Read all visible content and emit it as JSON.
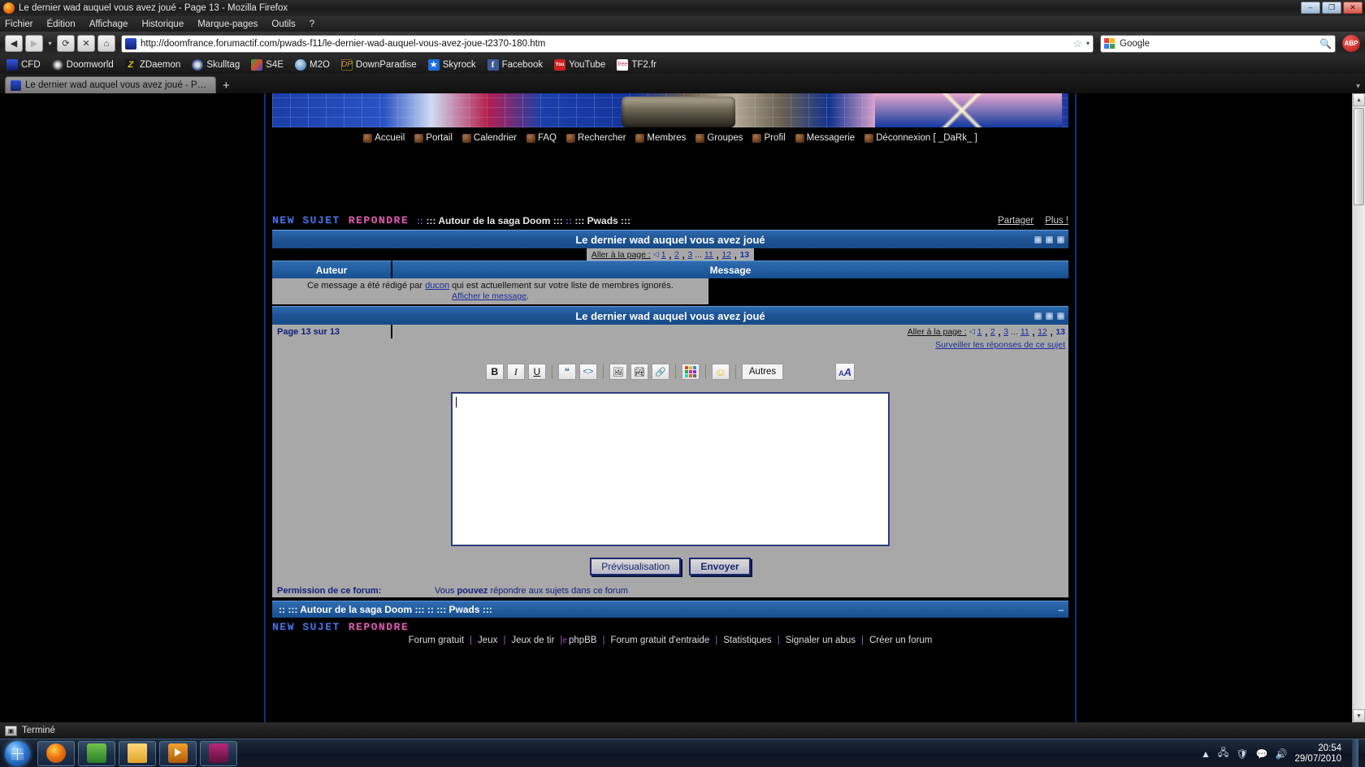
{
  "window": {
    "title": "Le dernier wad auquel vous avez joué - Page 13 - Mozilla Firefox",
    "minimize": "–",
    "maximize": "❐",
    "close": "✕"
  },
  "menubar": [
    "Fichier",
    "Édition",
    "Affichage",
    "Historique",
    "Marque-pages",
    "Outils",
    "?"
  ],
  "toolbar": {
    "back": "◀",
    "forward": "▶",
    "dropdown": "▾",
    "reload": "⟳",
    "stop": "✕",
    "home": "⌂",
    "url": "http://doomfrance.forumactif.com/pwads-f11/le-dernier-wad-auquel-vous-avez-joue-t2370-180.htm",
    "star": "☆",
    "star_caret": "▾",
    "search_value": "Google",
    "search_mag": "🔍",
    "adblock": "ABP"
  },
  "bookmarks": [
    {
      "label": "CFD",
      "icon": "cfd-icon"
    },
    {
      "label": "Doomworld",
      "icon": "doomworld-icon"
    },
    {
      "label": "ZDaemon",
      "icon": "zdaemon-icon",
      "glyph": "Z"
    },
    {
      "label": "Skulltag",
      "icon": "skulltag-icon"
    },
    {
      "label": "S4E",
      "icon": "s4e-icon"
    },
    {
      "label": "M2O",
      "icon": "m2o-icon"
    },
    {
      "label": "DownParadise",
      "icon": "downparadise-icon",
      "glyph": "DP"
    },
    {
      "label": "Skyrock",
      "icon": "skyrock-icon",
      "glyph": "★"
    },
    {
      "label": "Facebook",
      "icon": "facebook-icon",
      "glyph": "f"
    },
    {
      "label": "YouTube",
      "icon": "youtube-icon",
      "glyph": "You"
    },
    {
      "label": "TF2.fr",
      "icon": "tf2-icon",
      "glyph": "free"
    }
  ],
  "tab": {
    "label": "Le dernier wad auquel vous avez joué - Pa...",
    "newtab": "+",
    "listall": "▾"
  },
  "forum": {
    "topnav": [
      "Accueil",
      "Portail",
      "Calendrier",
      "FAQ",
      "Rechercher",
      "Membres",
      "Groupes",
      "Profil",
      "Messagerie",
      "Déconnexion [ _DaRk_ ]"
    ],
    "new_topic": "NEW SUJET",
    "reply": "REPONDRE",
    "breadcrumb_sep1": ":: ",
    "breadcrumb1": "::: Autour de la saga Doom :::",
    "breadcrumb_sep2": " :: ",
    "breadcrumb2": "::: Pwads :::",
    "share": "Partager",
    "more": "Plus !",
    "topic_title": "Le dernier wad auquel vous avez joué",
    "goto_label": "Aller à la page :",
    "goto_arrow": "◁",
    "pages": [
      "1",
      "2",
      "3"
    ],
    "pages_dots": "...",
    "pages_tail": [
      "11",
      "12"
    ],
    "current_page": "13",
    "col_author": "Auteur",
    "col_message": "Message",
    "ignored_pre": "Ce message a été rédigé par ",
    "ignored_user": "ducon",
    "ignored_post": " qui est actuellement sur votre liste de membres ignorés.",
    "show_message": "Afficher le message",
    "show_message_punct": ".",
    "page_counter": "Page 13 sur 13",
    "watch_topic": "Surveiller les réponses de ce sujet",
    "permission_label": "Permission de ce forum:",
    "permission_pre": "Vous ",
    "permission_bold": "pouvez",
    "permission_post": " répondre aux sujets dans ce forum",
    "footer_collapse": "–",
    "tb_icon1": "◆",
    "tb_icon2": "◆",
    "tb_icon3": "◆"
  },
  "editor": {
    "bold": "B",
    "italic": "I",
    "underline": "U",
    "quote": "❝",
    "code": "<>",
    "image": "🖼",
    "picture": "🏞",
    "link": "🔗",
    "color": "color-grid",
    "smiley": "☺",
    "others": "Autres",
    "spell_a": "A",
    "spell_b": "A",
    "textarea_value": "",
    "textarea_placeholder": "",
    "preview": "Prévisualisation",
    "send": "Envoyer"
  },
  "footer_links": [
    {
      "label": "Forum gratuit",
      "icon": ""
    },
    {
      "label": "Jeux",
      "icon": ""
    },
    {
      "label": "Jeux de tir",
      "icon": ""
    },
    {
      "label": "phpBB",
      "icon": "e"
    },
    {
      "label": "Forum gratuit d'entraide",
      "icon": ""
    },
    {
      "label": "Statistiques",
      "icon": ""
    },
    {
      "label": "Signaler un abus",
      "icon": ""
    },
    {
      "label": "Créer un forum",
      "icon": ""
    }
  ],
  "status": {
    "text": "Terminé",
    "icon": "page-icon"
  },
  "taskbar": {
    "start": "start-orb",
    "items": [
      "firefox",
      "explorer",
      "folder",
      "media-player",
      "doom"
    ],
    "tray_icons": [
      "▲",
      "🖧",
      "🛡",
      "💬",
      "🔊"
    ],
    "time": "20:54",
    "date": "29/07/2010"
  },
  "colors": {
    "forum_blue": "#1f5596",
    "gray_panel": "#a8a8a8",
    "link_blue": "#1c2d9c",
    "new_topic": "#4a6fd4",
    "reply_pink": "#cf5fa8"
  }
}
